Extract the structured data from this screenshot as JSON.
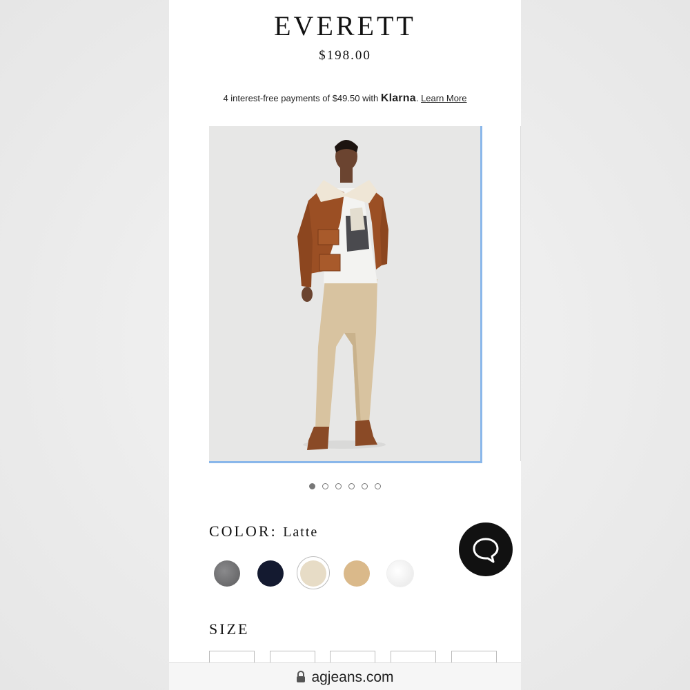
{
  "product": {
    "title": "EVERETT",
    "price": "$198.00"
  },
  "klarna": {
    "prefix": "4 interest-free payments of $49.50 with",
    "brand": "Klarna",
    "suffix": ".",
    "learn_more": "Learn More"
  },
  "gallery": {
    "slide_count": 6,
    "active_slide": 1
  },
  "color": {
    "label": "COLOR",
    "separator": ":",
    "selected": "Latte",
    "swatches": [
      {
        "name": "grey",
        "hex": "#6e6e70"
      },
      {
        "name": "navy",
        "hex": "#141a30"
      },
      {
        "name": "latte",
        "hex": "#e7dcc6"
      },
      {
        "name": "tan",
        "hex": "#dab98a"
      },
      {
        "name": "white",
        "hex": "#f4f4f4"
      }
    ]
  },
  "size": {
    "label": "SIZE"
  },
  "chat": {
    "icon": "chat-bubble-icon"
  },
  "browser": {
    "url": "agjeans.com",
    "icon": "lock-icon"
  }
}
